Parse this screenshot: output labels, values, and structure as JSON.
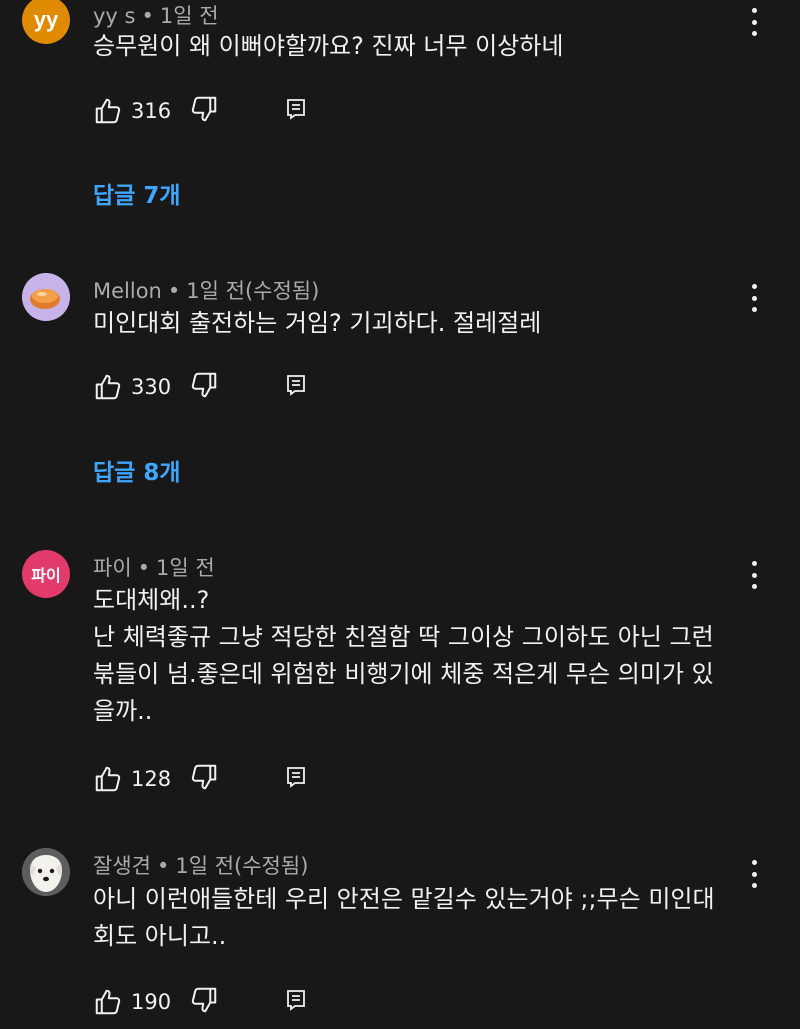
{
  "comments": [
    {
      "author": "yy s",
      "time": "1일 전",
      "avatar_text": "yy",
      "lines": [
        "승무원이 왜 이뻐야할까요? 진짜 너무 이상하네"
      ],
      "likes": "316",
      "replies": "답글 7개"
    },
    {
      "author": "Mellon",
      "time": "1일 전(수정됨)",
      "avatar_text": "",
      "lines": [
        "미인대회 출전하는 거임? 기괴하다. 절레절레"
      ],
      "likes": "330",
      "replies": "답글 8개"
    },
    {
      "author": "파이",
      "time": "1일 전",
      "avatar_text": "파이",
      "lines": [
        "도대체왜..?",
        "난 체력좋규 그냥 적당한 친절함 딱 그이상 그이하도 아닌 그런",
        "붂들이 넘.좋은데 위험한 비행기에 체중 적은게 무슨 의미가 있",
        "을까.."
      ],
      "likes": "128",
      "replies": ""
    },
    {
      "author": "잘생견",
      "time": "1일 전(수정됨)",
      "avatar_text": "",
      "lines": [
        "아니 이런애들한테 우리 안전은 맡길수 있는거야 ;;무슨 미인대",
        "회도 아니고.."
      ],
      "likes": "190",
      "replies": ""
    }
  ],
  "ui": {
    "separator": "•",
    "icons": {
      "like": "thumb-up-icon",
      "dislike": "thumb-down-icon",
      "reply": "reply-comment-icon",
      "more": "more-vertical-icon"
    },
    "colors": {
      "background": "#181818",
      "text": "#f1f1f1",
      "meta": "#aaaaaa",
      "link": "#3ea6ff"
    }
  }
}
